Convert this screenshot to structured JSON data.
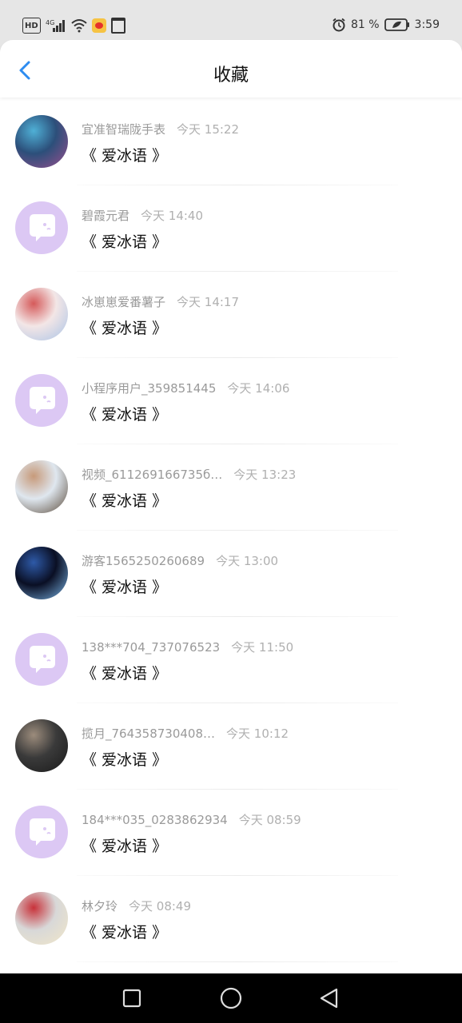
{
  "status_bar": {
    "network": "4G",
    "battery": "81",
    "time": "3:59"
  },
  "header": {
    "title": "收藏"
  },
  "items": [
    {
      "name": "宜准智瑞陇手表",
      "time": "今天 15:22",
      "text": "《 爱冰语 》",
      "avatar_type": "photo",
      "avatar_colors": [
        "#2c4f7a",
        "#4fb0d6",
        "#9a4f8e"
      ]
    },
    {
      "name": "碧霞元君",
      "time": "今天 14:40",
      "text": "《 爱冰语 》",
      "avatar_type": "default"
    },
    {
      "name": "冰崽崽爱番薯子",
      "time": "今天 14:17",
      "text": "《 爱冰语 》",
      "avatar_type": "photo",
      "avatar_colors": [
        "#f3e6e6",
        "#d55a5a",
        "#a9c3e6"
      ]
    },
    {
      "name": "小程序用户_359851445",
      "time": "今天 14:06",
      "text": "《 爱冰语 》",
      "avatar_type": "default"
    },
    {
      "name": "视频_611269166735б…",
      "time": "今天 13:23",
      "text": "《 爱冰语 》",
      "avatar_type": "photo",
      "avatar_colors": [
        "#dfe7ef",
        "#c79a7a",
        "#5a4a3a"
      ]
    },
    {
      "name": "游客1565250260689",
      "time": "今天 13:00",
      "text": "《 爱冰语 》",
      "avatar_type": "photo",
      "avatar_colors": [
        "#0a0f24",
        "#2e5aa8",
        "#7ab4e6"
      ]
    },
    {
      "name": "138***704_737076523",
      "time": "今天 11:50",
      "text": "《 爱冰语 》",
      "avatar_type": "default"
    },
    {
      "name": "揽月_764358730408…",
      "time": "今天 10:12",
      "text": "《 爱冰语 》",
      "avatar_type": "photo",
      "avatar_colors": [
        "#3a3a3a",
        "#9c8c7c",
        "#1a1a1a"
      ]
    },
    {
      "name": "184***035_0283862934",
      "time": "今天 08:59",
      "text": "《 爱冰语 》",
      "avatar_type": "default"
    },
    {
      "name": "林夕玲",
      "time": "今天 08:49",
      "text": "《 爱冰语 》",
      "avatar_type": "photo",
      "avatar_colors": [
        "#d8d8d8",
        "#c8323a",
        "#f1e6c8"
      ]
    }
  ],
  "colors": {
    "accent": "#2d8cf0",
    "default_avatar_bg": "#dcc8f4",
    "default_avatar_bubble": "#ffffff"
  }
}
